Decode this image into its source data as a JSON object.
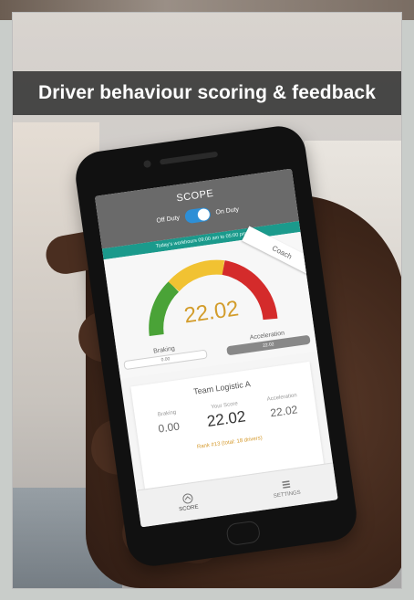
{
  "banner": {
    "title": "Driver behaviour scoring & feedback"
  },
  "app": {
    "title": "SCOPE",
    "duty": {
      "off_label": "Off Duty",
      "on_label": "On Duty"
    },
    "status_bar": "Today's workhours 09:00 am to 05:00 pm",
    "coach_label": "Coach",
    "score": "22.02",
    "gauge_colors": {
      "green": "#4aa337",
      "yellow": "#f1c232",
      "red": "#d42b2b"
    },
    "braking": {
      "label": "Braking",
      "value": "0.00"
    },
    "acceleration": {
      "label": "Acceleration",
      "value": "22.02"
    },
    "team_card": {
      "title": "Team Logistic A",
      "stats": [
        {
          "label": "Braking",
          "value": "0.00"
        },
        {
          "label": "Your Score",
          "value": "22.02"
        },
        {
          "label": "Acceleration",
          "value": "22.02"
        }
      ],
      "rank_text": "Rank #13 (total: 18 drivers)"
    },
    "nav": [
      {
        "label": "SCORE",
        "icon": "score-icon"
      },
      {
        "label": "SETTINGS",
        "icon": "settings-icon"
      }
    ]
  }
}
